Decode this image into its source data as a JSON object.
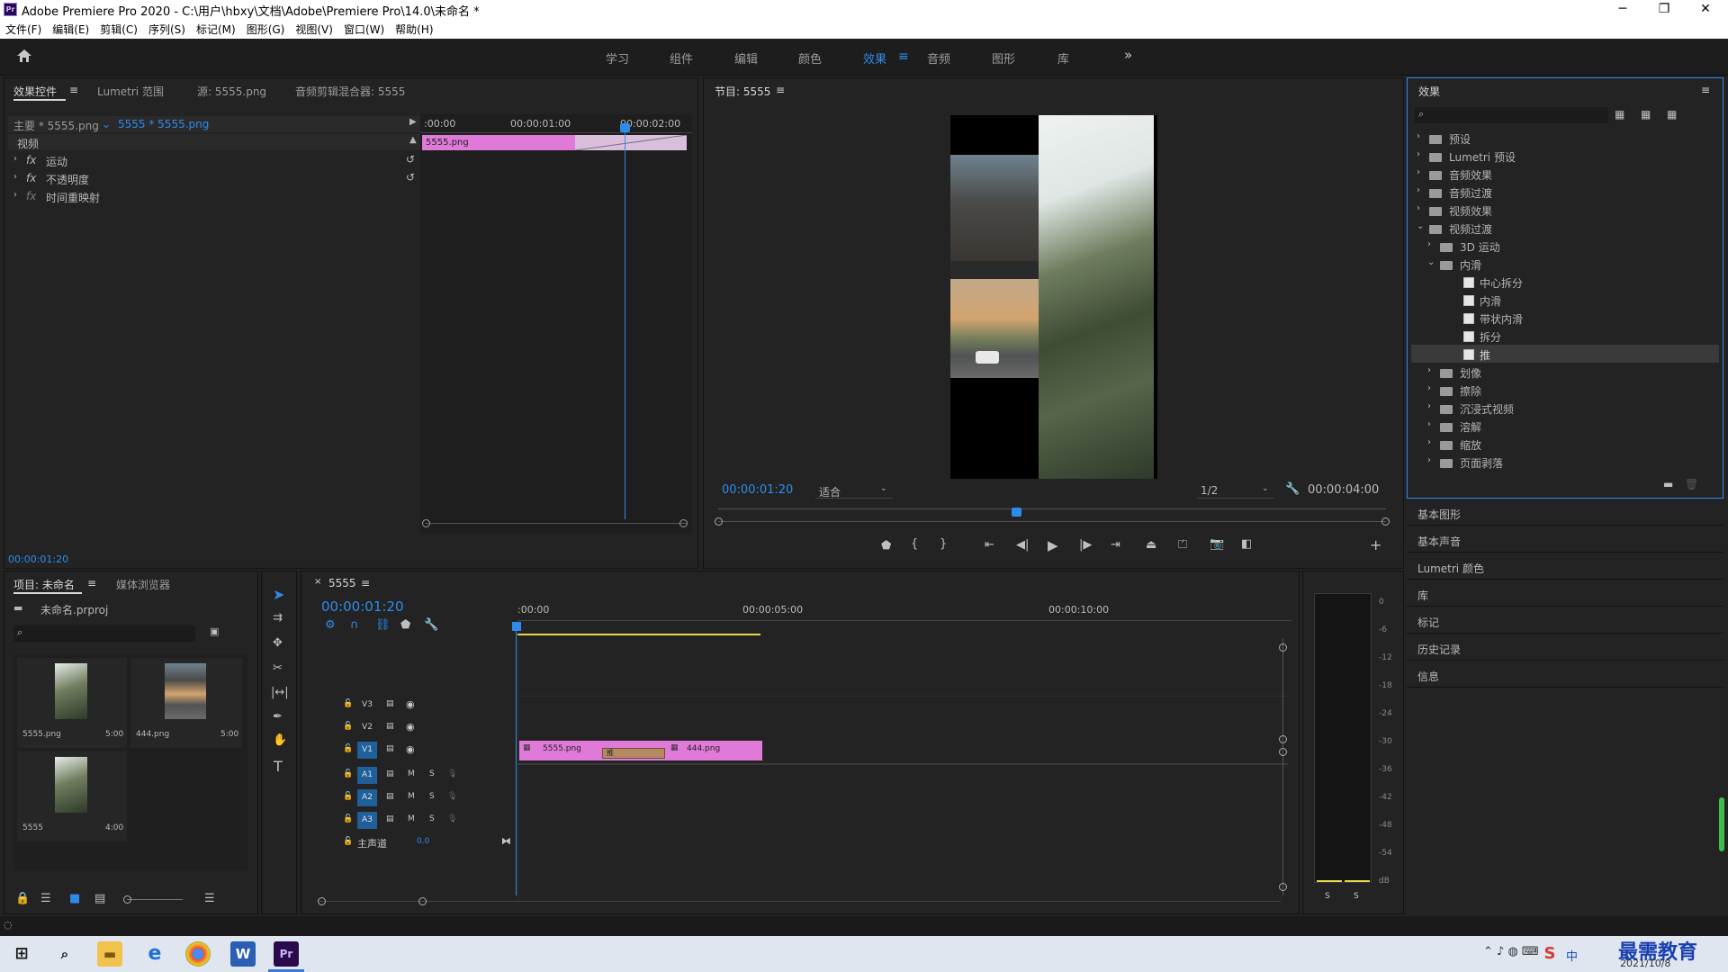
{
  "window": {
    "title": "Adobe Premiere Pro 2020 - C:\\用户\\hbxy\\文档\\Adobe\\Premiere Pro\\14.0\\未命名 *",
    "app_icon": "Pr",
    "controls": [
      "─",
      "❐",
      "✕"
    ]
  },
  "menu": [
    "文件(F)",
    "编辑(E)",
    "剪辑(C)",
    "序列(S)",
    "标记(M)",
    "图形(G)",
    "视图(V)",
    "窗口(W)",
    "帮助(H)"
  ],
  "workspaces": [
    "学习",
    "组件",
    "编辑",
    "颜色",
    "效果",
    "音频",
    "图形",
    "库"
  ],
  "active_workspace": "效果",
  "more": "»",
  "effect_controls": {
    "tabs": [
      "效果控件",
      "Lumetri 范围",
      "源: 5555.png",
      "音频剪辑混合器: 5555"
    ],
    "master": "主要 * 5555.png",
    "clip": "5555 * 5555.png",
    "section": "视频",
    "props": [
      {
        "fx": "fx",
        "label": "运动"
      },
      {
        "fx": "fx",
        "label": "不透明度"
      },
      {
        "fx": "fx",
        "label": "时间重映射"
      }
    ],
    "ruler": [
      ":00:00",
      "00:00:01:00",
      "00:00:02:00"
    ],
    "clip_label": "5555.png",
    "timecode": "00:00:01:20"
  },
  "program": {
    "title": "节目: 5555",
    "timecode": "00:00:01:20",
    "fit": "适合",
    "quality": "1/2",
    "duration": "00:00:04:00"
  },
  "effects_panel": {
    "title": "效果",
    "tree": [
      {
        "label": "预设",
        "level": 0,
        "type": "folder-star",
        "open": false
      },
      {
        "label": "Lumetri 预设",
        "level": 0,
        "type": "folder-star",
        "open": false
      },
      {
        "label": "音频效果",
        "level": 0,
        "type": "folder",
        "open": false
      },
      {
        "label": "音频过渡",
        "level": 0,
        "type": "folder",
        "open": false
      },
      {
        "label": "视频效果",
        "level": 0,
        "type": "folder",
        "open": false
      },
      {
        "label": "视频过渡",
        "level": 0,
        "type": "folder",
        "open": true
      },
      {
        "label": "3D 运动",
        "level": 1,
        "type": "folder",
        "open": false
      },
      {
        "label": "内滑",
        "level": 1,
        "type": "folder",
        "open": true
      },
      {
        "label": "中心拆分",
        "level": 2,
        "type": "fx"
      },
      {
        "label": "内滑",
        "level": 2,
        "type": "fx"
      },
      {
        "label": "带状内滑",
        "level": 2,
        "type": "fx"
      },
      {
        "label": "拆分",
        "level": 2,
        "type": "fx"
      },
      {
        "label": "推",
        "level": 2,
        "type": "fx",
        "selected": true
      },
      {
        "label": "划像",
        "level": 1,
        "type": "folder",
        "open": false
      },
      {
        "label": "擦除",
        "level": 1,
        "type": "folder",
        "open": false
      },
      {
        "label": "沉浸式视频",
        "level": 1,
        "type": "folder",
        "open": false
      },
      {
        "label": "溶解",
        "level": 1,
        "type": "folder",
        "open": false
      },
      {
        "label": "缩放",
        "level": 1,
        "type": "folder",
        "open": false
      },
      {
        "label": "页面剥落",
        "level": 1,
        "type": "folder",
        "open": false
      }
    ],
    "other_panels": [
      "基本图形",
      "基本声音",
      "Lumetri 颜色",
      "库",
      "标记",
      "历史记录",
      "信息"
    ]
  },
  "project": {
    "tabs": [
      "项目: 未命名",
      "媒体浏览器"
    ],
    "file": "未命名.prproj",
    "items": [
      {
        "name": "5555.png",
        "dur": "5:00"
      },
      {
        "name": "444.png",
        "dur": "5:00"
      },
      {
        "name": "5555",
        "dur": "4:00"
      }
    ]
  },
  "timeline": {
    "tab": "5555",
    "timecode": "00:00:01:20",
    "ruler": [
      ":00:00",
      "00:00:05:00",
      "00:00:10:00"
    ],
    "video_tracks": [
      "V3",
      "V2",
      "V1"
    ],
    "audio_tracks": [
      "A1",
      "A2",
      "A3"
    ],
    "master": "主声道",
    "master_val": "0.0",
    "clips": [
      {
        "label": "5555.png"
      },
      {
        "label": "444.png"
      }
    ],
    "transition": "推",
    "m": "M",
    "s": "S"
  },
  "meter": {
    "scale": [
      "0",
      "-6",
      "-12",
      "-18",
      "-24",
      "-30",
      "-36",
      "-42",
      "-48",
      "-54",
      "dB"
    ],
    "solo": [
      "S",
      "S"
    ]
  },
  "taskbar": {
    "clock_date": "2021/10/8",
    "ime": "中",
    "watermark": "最需教育"
  },
  "colors": {
    "accent": "#2d8ceb",
    "clip_pink": "#e07ad8",
    "transition": "#b58a63",
    "bg": "#232323"
  }
}
